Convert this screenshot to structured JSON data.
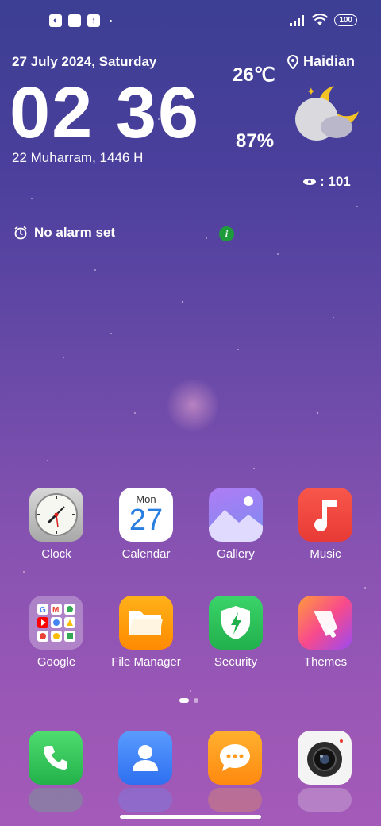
{
  "status": {
    "battery": "100"
  },
  "lockinfo": {
    "date": "27 July 2024, Saturday",
    "time": "02 36",
    "hijri": "22 Muharram, 1446 H",
    "temperature": "26℃",
    "humidity": "87%",
    "location": "Haidian",
    "aqi": ": 101",
    "alarm": "No alarm set"
  },
  "apps": [
    {
      "label": "Clock"
    },
    {
      "label": "Calendar",
      "cal_day": "Mon",
      "cal_date": "27"
    },
    {
      "label": "Gallery"
    },
    {
      "label": "Music"
    },
    {
      "label": "Google"
    },
    {
      "label": "File Manager"
    },
    {
      "label": "Security"
    },
    {
      "label": "Themes"
    }
  ],
  "dock": [
    "phone-icon",
    "contacts-icon",
    "messages-icon",
    "camera-icon"
  ],
  "colors": {
    "accent_green": "#1e9c3b",
    "music_red": "#f0473c",
    "security_green": "#2fc25b"
  }
}
